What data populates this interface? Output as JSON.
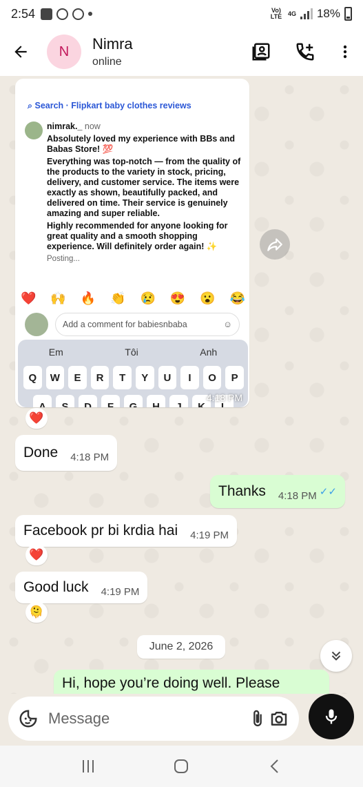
{
  "status_bar": {
    "time": "2:54",
    "network_small": "Vo) LTE",
    "network_type": "4G",
    "battery": "18%"
  },
  "header": {
    "avatar_letter": "N",
    "contact_name": "Nimra",
    "contact_status": "online"
  },
  "shared_post": {
    "search_label": "Search · Flipkart baby clothes reviews",
    "username": "nimrak._",
    "posted": "now",
    "paragraph1": "Absolutely loved my experience with BBs and Babas Store! 💯",
    "paragraph2": "Everything was top-notch — from the quality of the products to the variety in stock, pricing, delivery, and customer service. The items were exactly as shown, beautifully packed, and delivered on time. Their service is genuinely amazing and super reliable.",
    "paragraph3": "Highly recommended for anyone looking for great quality and a smooth shopping experience. Will definitely order again! ✨",
    "status": "Posting...",
    "emoji_bar": [
      "❤️",
      "🙌",
      "🔥",
      "👏",
      "😢",
      "😍",
      "😮",
      "😂"
    ],
    "comment_placeholder": "Add a comment for babiesnbaba",
    "keyboard_suggestions": [
      "Em",
      "Tôi",
      "Anh"
    ],
    "keyboard_row1": [
      "Q",
      "W",
      "E",
      "R",
      "T",
      "Y",
      "U",
      "I",
      "O",
      "P"
    ],
    "keyboard_row2": [
      "A",
      "S",
      "D",
      "F",
      "G",
      "H",
      "J",
      "K",
      "L"
    ],
    "time": "4:18 PM",
    "reaction": "❤️"
  },
  "messages": [
    {
      "direction": "in",
      "text": "Done",
      "time": "4:18 PM"
    },
    {
      "direction": "out",
      "text": "Thanks",
      "time": "4:18 PM",
      "ticks": "✓✓"
    },
    {
      "direction": "in",
      "text": "Facebook pr bi krdia hai",
      "time": "4:19 PM",
      "reaction": "❤️"
    },
    {
      "direction": "in",
      "text": "Good luck",
      "time": "4:19 PM",
      "reaction": "🫠"
    }
  ],
  "date_divider": "June 2, 2026",
  "partial_message": {
    "direction": "out",
    "text": "Hi, hope you’re doing well. Please"
  },
  "composer": {
    "placeholder": "Message"
  },
  "colors": {
    "chat_background": "#efeae2",
    "outgoing_bubble": "#d9fdd3",
    "incoming_bubble": "#ffffff",
    "read_ticks": "#3b9fe8",
    "mic_button": "#111111"
  },
  "icons": [
    "back-arrow-icon",
    "contact-card-icon",
    "add-call-icon",
    "more-vert-icon",
    "forward-icon",
    "sticker-icon",
    "attach-icon",
    "camera-icon",
    "mic-icon",
    "chevron-double-down-icon",
    "nav-recents-icon",
    "nav-home-icon",
    "nav-back-icon"
  ]
}
